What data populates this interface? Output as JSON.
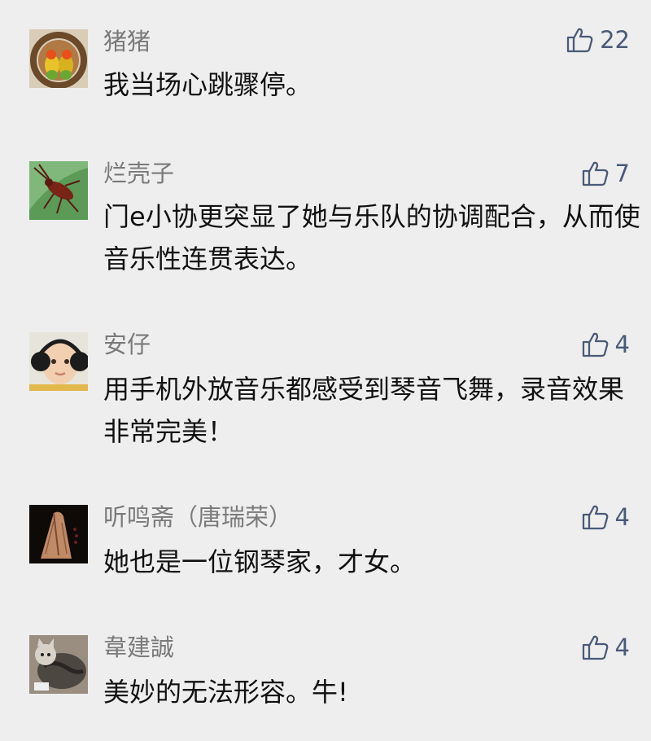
{
  "colors": {
    "background": "#eeeeee",
    "name": "#7a7a7a",
    "text": "#111111",
    "like": "#4a5a78"
  },
  "comments": [
    {
      "name": "猪猪",
      "text": "我当场心跳骤停。",
      "likes": "22",
      "avatar_icon": "lovebirds-avatar"
    },
    {
      "name": "烂壳子",
      "text": "门e小协更突显了她与乐队的协调配合，从而使音乐性连贯表达。",
      "likes": "7",
      "avatar_icon": "insect-on-leaf-avatar"
    },
    {
      "name": "安仔",
      "text": "用手机外放音乐都感受到琴音飞舞，录音效果非常完美！",
      "likes": "4",
      "avatar_icon": "baby-earmuffs-avatar"
    },
    {
      "name": "听鸣斋（唐瑞荣）",
      "text": "她也是一位钢琴家，才女。",
      "likes": "4",
      "avatar_icon": "praying-hands-avatar"
    },
    {
      "name": "韋建誠",
      "text": "美妙的无法形容。牛!",
      "likes": "4",
      "avatar_icon": "cat-avatar"
    }
  ]
}
